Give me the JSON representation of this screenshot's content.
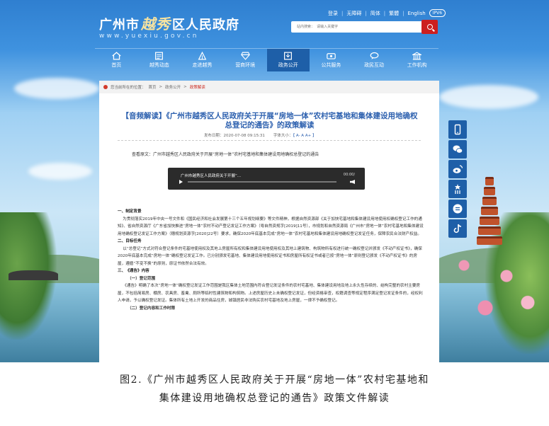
{
  "site": {
    "logo_pre": "广州市",
    "logo_script": "越秀",
    "logo_post": "区人民政府",
    "url": "www.yuexiu.gov.cn"
  },
  "toplinks": {
    "login": "登录",
    "barrier_free": "无障碍",
    "simplified": "简体",
    "traditional": "繁體",
    "english": "English",
    "ipv6": "IPV6"
  },
  "search": {
    "placeholder": "站内搜索：  请输入关键字"
  },
  "nav": {
    "items": [
      {
        "label": "首页",
        "icon": "home-icon"
      },
      {
        "label": "越秀动态",
        "icon": "news-icon"
      },
      {
        "label": "走进越秀",
        "icon": "landmark-icon"
      },
      {
        "label": "营商环境",
        "icon": "diamond-icon"
      },
      {
        "label": "政务公开",
        "icon": "document-icon"
      },
      {
        "label": "公共服务",
        "icon": "service-icon"
      },
      {
        "label": "政民互动",
        "icon": "chat-icon"
      },
      {
        "label": "工作机构",
        "icon": "building-icon"
      }
    ],
    "active_index": 4
  },
  "breadcrumb": {
    "prefix": "您当前所在的位置：",
    "home": "首页",
    "sep1": ">",
    "level1": "政务公开",
    "sep2": ">",
    "current": "政策解读"
  },
  "article": {
    "title": "【音频解读】《广州市越秀区人民政府关于开展“房地一体”农村宅基地和集体建设用地确权总登记的通告》的政策解读",
    "publish_time": "发布日期：2020-07-08 09:15:31",
    "font_size_label": "字体大小：",
    "font_size_options": "【 A-  A  A+ 】",
    "source": "查看原文：广州市越秀区人民政府关于开展“房地一体”农村宅基地和集体建设用地确权总登记的通告",
    "player_title": "广州市越秀区人民政府关于开展“...",
    "player_time": "00:00/",
    "sections": {
      "h1": "一、制定背景",
      "p1": "为贯彻落实2019年中央一号文件和《国民经济和社会发展第十三个五年规划纲要》等文件精神，根据自然资源部《关于加快宅基地和集体建设用地使用权确权登记工作的通知》、省自然资源厅《广东省加快推进“房地一体”农村不动产登记发证工作方案》（粤自然资规字[2019]11号），市规划和自然资源局《广州市“房地一体”农村宅基地和集体建设用地确权登记发证工作方案》（穗规划资源字[2020]22号）要求，确保2020年底基本完成“房地一体”农村宅基地和集体建设用地确权登记发证任务，保障农民合法财产权益。",
      "h2": "二、目标任务",
      "p2": "以“总登记”方式对符合登记条件的宅基地使用权及其地上房屋所有权和集体建设用地使用权及其地上建筑物、构筑物所有权进行统一确权登记并颁发《不动产权证书》，确保2020年底基本完成“房地一体”确权登记发证工作。已分别颁发宅基地、集体建设用地使用权证书和房屋所有权证书或者已按“房地一体”原则登记颁发《不动产权证书》的房屋，遵循“不变不换”的原则，原证书依然合法有效。",
      "h3": "三、《通告》内容",
      "sub1": "（一）登记范围",
      "p3": "《通告》明确了本次“房地一体”确权登记发证工作范围是我区集体土地范围内符合登记发证条件的农村宅基地、集体建设用地及地上永久性存续的、结构完整的农村主要房屋，不包括简易房、棚房、农具房、畜禽、厕所等临时性建筑物和构筑物。上述房屋历史上未确权登记发证，但经资格审查，权籍调查等规定程序满足登记发证条件的，经权利人申请，予以确权登记发证。集体所有土地上开发的商品住房，城镇居民非法购买农村宅基地及地上房屋，一律不予确权登记。",
      "sub2": "（二）登记内容和工作时限"
    }
  },
  "sidebar": {
    "icons": [
      "mobile-icon",
      "wechat-icon",
      "weibo-icon",
      "app-icon",
      "toutiao-icon",
      "douyin-icon"
    ]
  },
  "caption": {
    "line1": "图2.《广州市越秀区人民政府关于开展“房地一体”农村宅基地和",
    "line2": "集体建设用地确权总登记的通告》政策文件解读"
  },
  "colors": {
    "primary_blue": "#1e5fa8",
    "title_blue": "#2b5fae",
    "search_red": "#cc1f1f",
    "crumb_red": "#cc2a1f"
  }
}
